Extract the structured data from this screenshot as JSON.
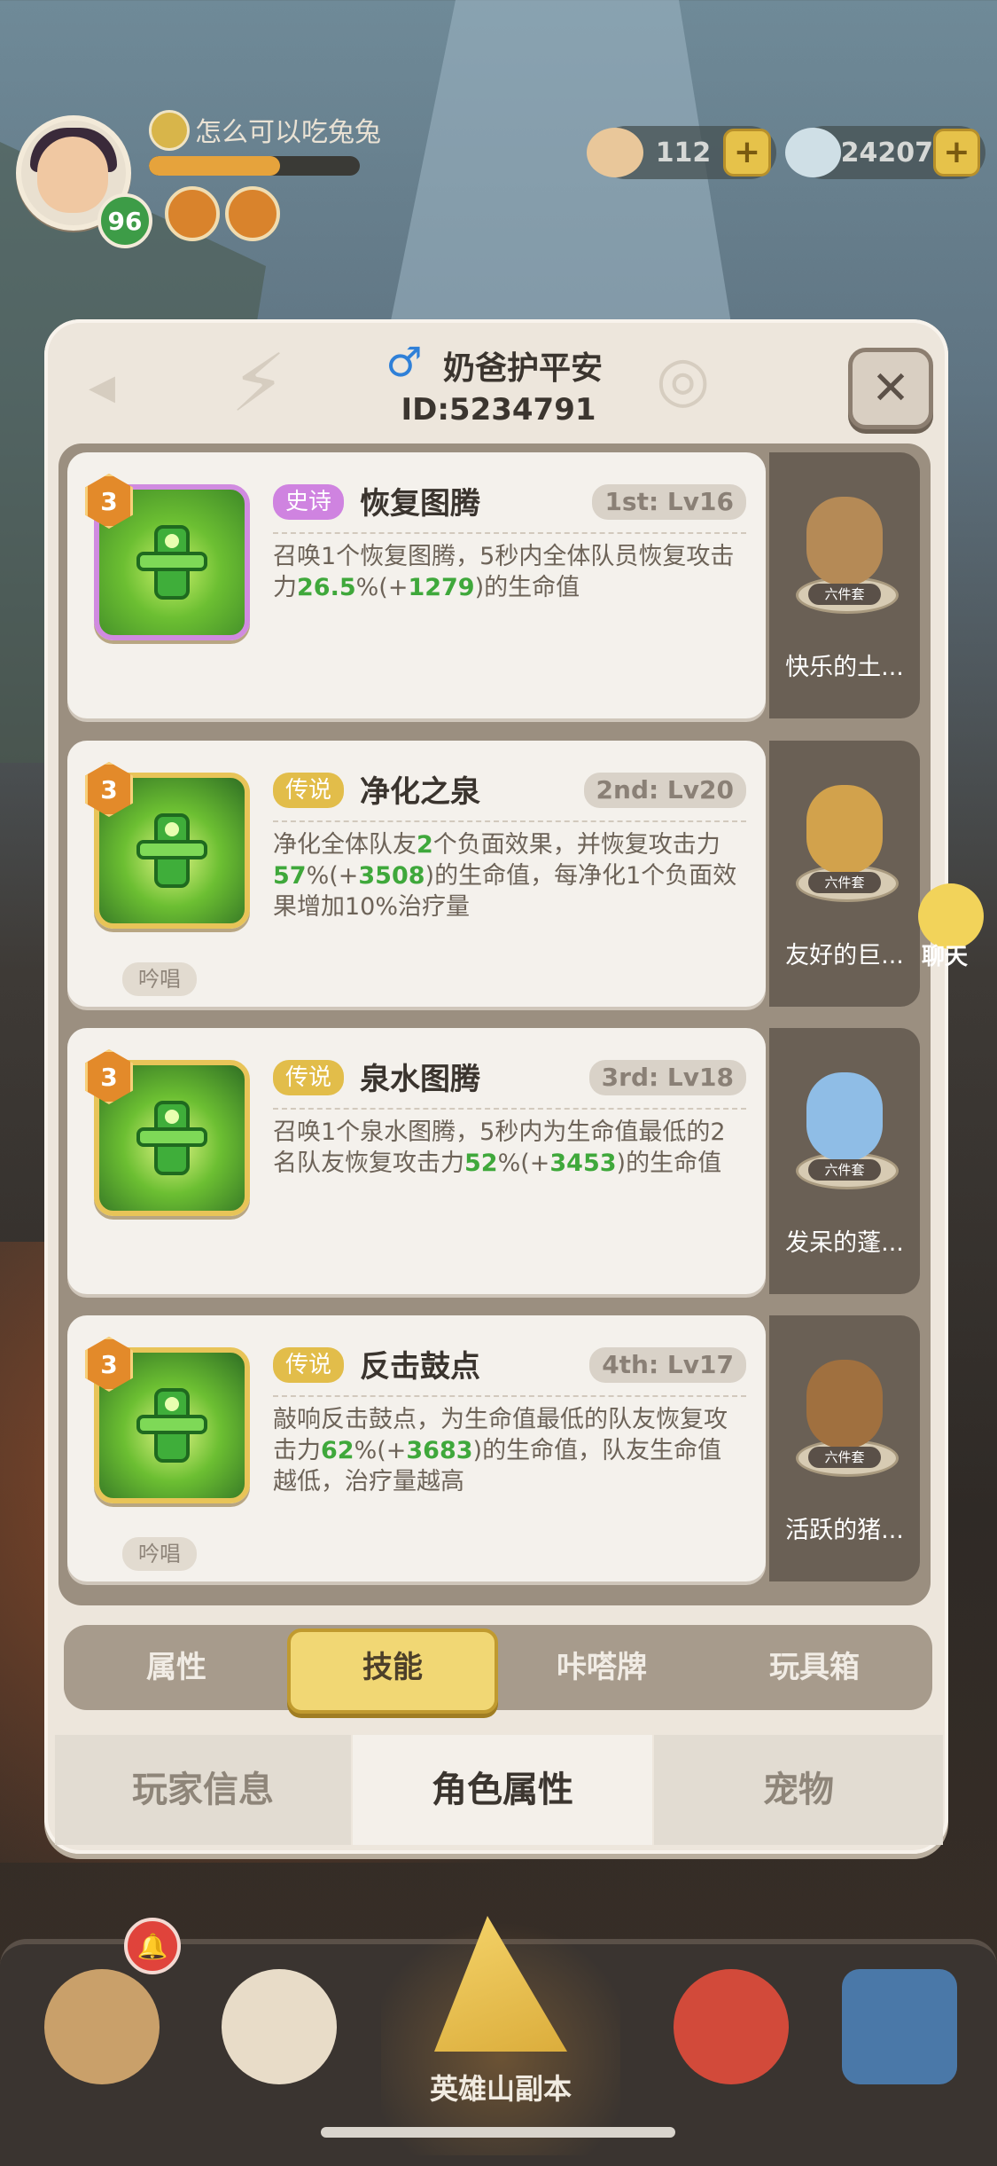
{
  "hud": {
    "player_name": "怎么可以吃兔兔",
    "level": "96",
    "exp_progress": 0.62,
    "currency_shells": "112",
    "currency_gems": "24207",
    "plus": "+"
  },
  "panel": {
    "gender_symbol": "♂",
    "title": "奶爸护平安",
    "id_text": "ID:5234791",
    "close": "✕"
  },
  "skills": [
    {
      "rarity": "史诗",
      "rarity_type": "epic",
      "name": "恢复图腾",
      "slot_lv": "1st: Lv16",
      "level_badge": "3",
      "desc_parts": [
        "召唤1个恢复图腾，5秒内全体队员恢复攻击力",
        "26.5",
        "%(+",
        "1279",
        ")的生命值"
      ],
      "tag": "",
      "set_name": "快乐的土...",
      "set_tag": "六件套"
    },
    {
      "rarity": "传说",
      "rarity_type": "legend",
      "name": "净化之泉",
      "slot_lv": "2nd: Lv20",
      "level_badge": "3",
      "desc_parts": [
        "净化全体队友",
        "2",
        "个负面效果，并恢复攻击力",
        "57",
        "%(+",
        "3508",
        ")的生命值，每净化1个负面效果增加10%治疗量"
      ],
      "tag": "吟唱",
      "set_name": "友好的巨...",
      "set_tag": "六件套"
    },
    {
      "rarity": "传说",
      "rarity_type": "legend",
      "name": "泉水图腾",
      "slot_lv": "3rd: Lv18",
      "level_badge": "3",
      "desc_parts": [
        "召唤1个泉水图腾，5秒内为生命值最低的2名队友恢复攻击力",
        "52",
        "%(+",
        "3453",
        ")的生命值"
      ],
      "tag": "",
      "set_name": "发呆的蓬...",
      "set_tag": "六件套"
    },
    {
      "rarity": "传说",
      "rarity_type": "legend",
      "name": "反击鼓点",
      "slot_lv": "4th: Lv17",
      "level_badge": "3",
      "desc_parts": [
        "敲响反击鼓点，为生命值最低的队友恢复攻击力",
        "62",
        "%(+",
        "3683",
        ")的生命值，队友生命值越低，治疗量越高"
      ],
      "tag": "吟唱",
      "set_name": "活跃的猪...",
      "set_tag": "六件套"
    }
  ],
  "chat_label": "聊天",
  "inner_tabs": [
    "属性",
    "技能",
    "咔嗒牌",
    "玩具箱"
  ],
  "inner_tab_active": 1,
  "bottom_tabs": [
    "玩家信息",
    "角色属性",
    "宠物"
  ],
  "bottom_tab_active": 1,
  "nav": {
    "center_label": "英雄山副本",
    "notif": "🔔"
  },
  "colors": {
    "highlight_green": "#3fa83b",
    "epic": "#cf83e0",
    "legend": "#e2bd4a",
    "active_tab": "#f1d774"
  }
}
